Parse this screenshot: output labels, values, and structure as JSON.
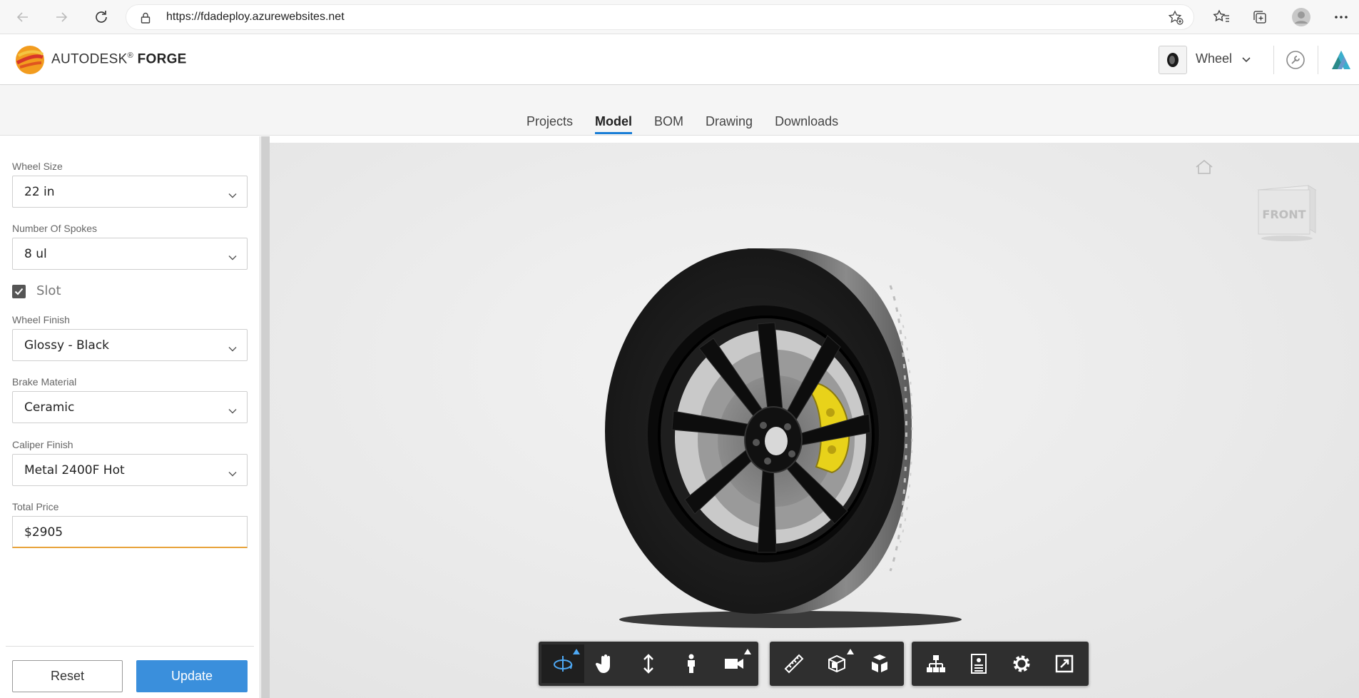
{
  "browser": {
    "url": "https://fdadeploy.azurewebsites.net",
    "icons": [
      "back-icon",
      "forward-icon",
      "refresh-icon",
      "lock-icon",
      "add-favorite-icon",
      "favorites-icon",
      "collections-icon",
      "profile-icon",
      "more-icon"
    ]
  },
  "header": {
    "brand_prefix": "AUTODESK",
    "brand_reg": "®",
    "brand_suffix": "FORGE",
    "model_name": "Wheel",
    "icons": [
      "forge-logo-icon",
      "wheel-thumbnail-icon",
      "chevron-down-icon",
      "wrench-icon",
      "autodesk-a-icon"
    ]
  },
  "tabs": [
    {
      "label": "Projects",
      "active": false
    },
    {
      "label": "Model",
      "active": true
    },
    {
      "label": "BOM",
      "active": false
    },
    {
      "label": "Drawing",
      "active": false
    },
    {
      "label": "Downloads",
      "active": false
    }
  ],
  "form": {
    "wheel_size_label": "Wheel Size",
    "wheel_size_value": "22 in",
    "spokes_label": "Number Of Spokes",
    "spokes_value": "8 ul",
    "slot_label": "Slot",
    "slot_checked": true,
    "finish_label": "Wheel Finish",
    "finish_value": "Glossy - Black",
    "brake_label": "Brake Material",
    "brake_value": "Ceramic",
    "caliper_label": "Caliper Finish",
    "caliper_value": "Metal 2400F Hot",
    "price_label": "Total Price",
    "price_value": "$2905",
    "reset_label": "Reset",
    "update_label": "Update"
  },
  "viewer": {
    "viewcube_face": "FRONT",
    "toolbar_groups": [
      [
        "orbit-icon",
        "pan-icon",
        "zoom-icon",
        "first-person-icon",
        "camera-icon"
      ],
      [
        "measure-icon",
        "section-icon",
        "explode-icon"
      ],
      [
        "model-browser-icon",
        "properties-icon",
        "settings-icon",
        "fullscreen-icon"
      ]
    ],
    "accent_color": "#4ea9f5"
  },
  "colors": {
    "tab_underline": "#1a7ed6",
    "update_button": "#3a8fdc",
    "price_underline": "#e8a33a"
  }
}
